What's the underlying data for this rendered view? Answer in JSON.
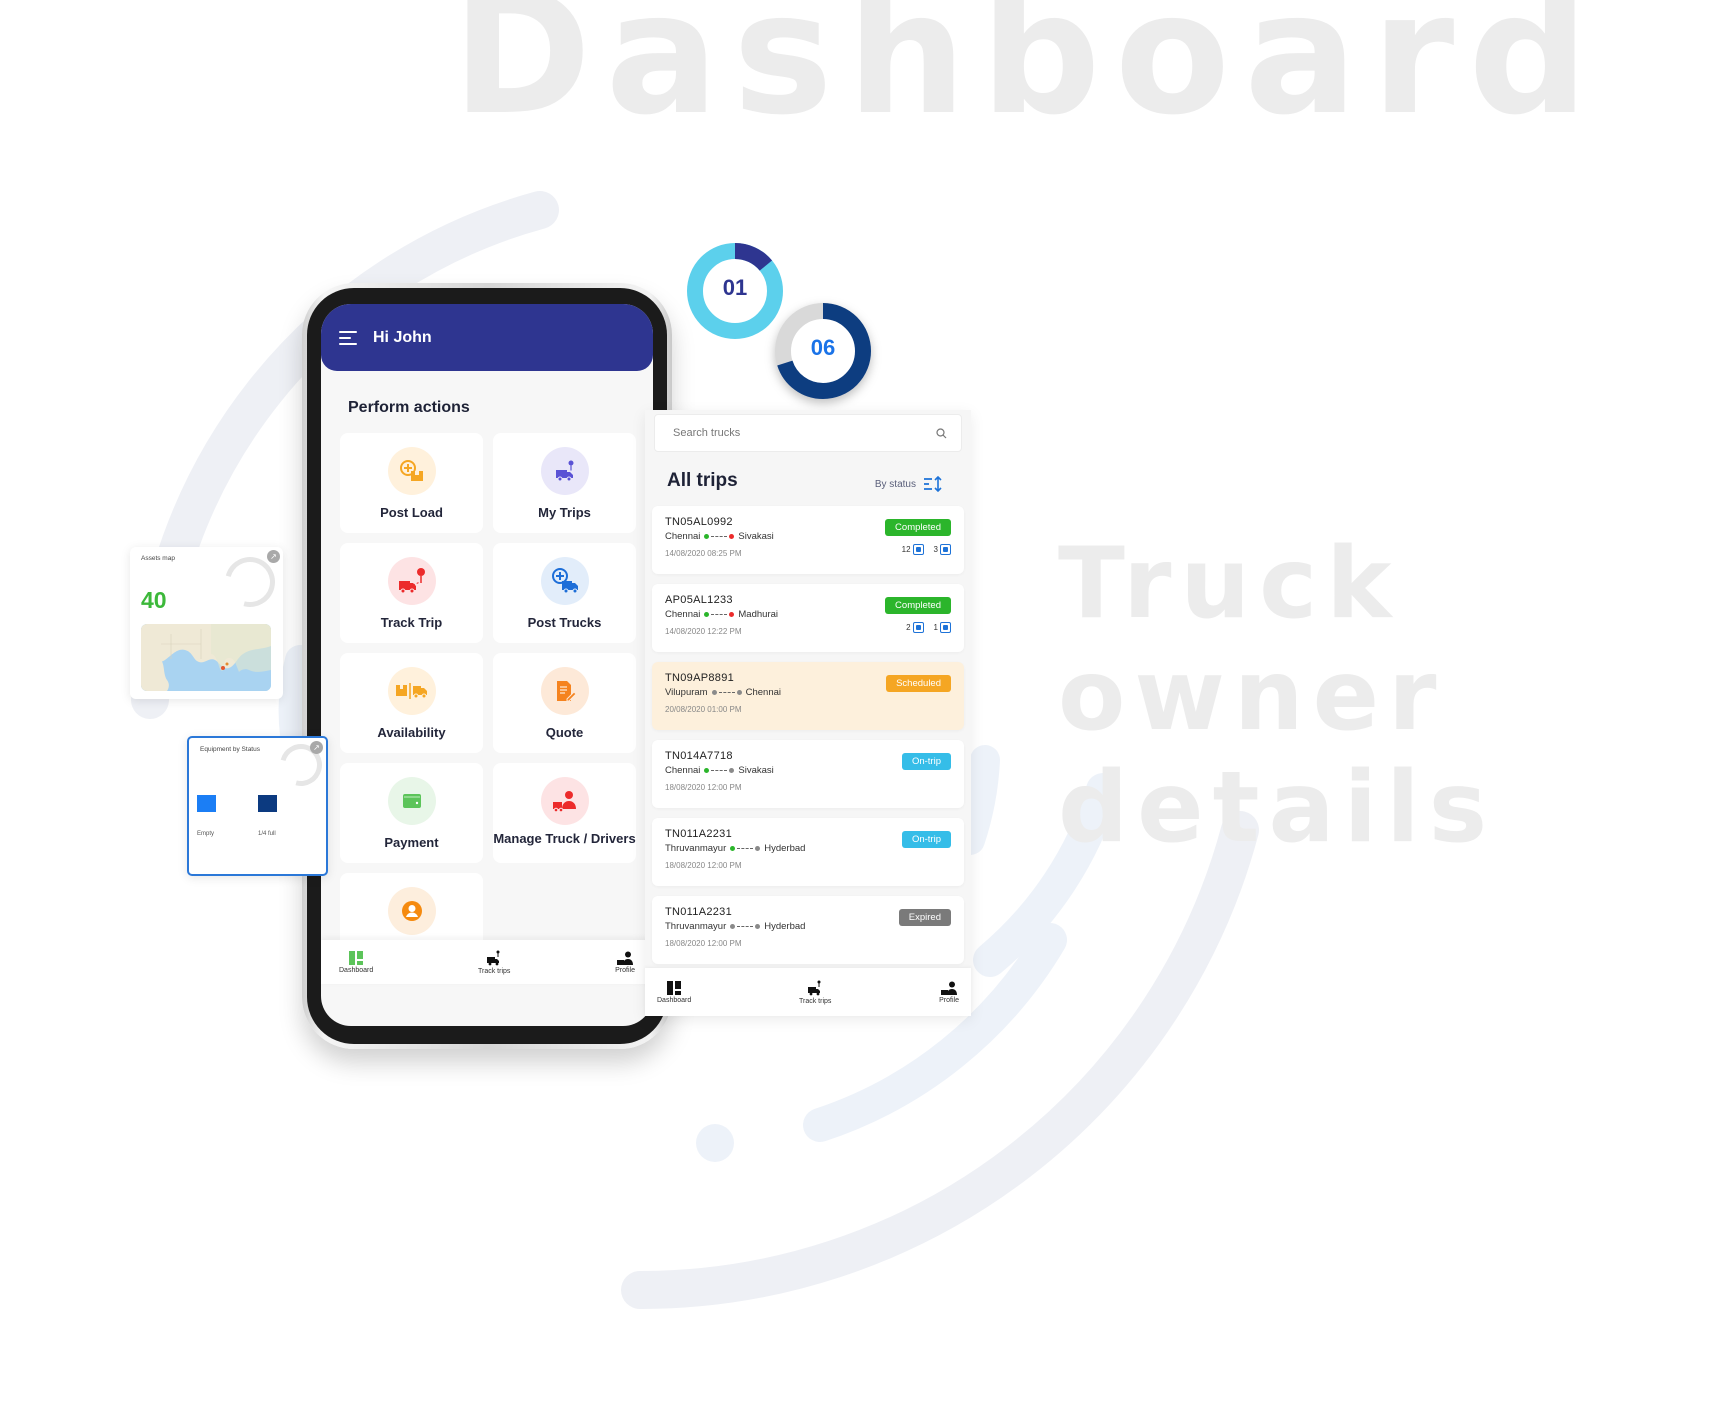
{
  "background": {
    "title": "Dashboard",
    "subtitle": "Truck owner details"
  },
  "donuts": [
    {
      "label": "01",
      "progress": 0.14,
      "track_color": "#5cd0ec",
      "fill_color": "#2e3590",
      "text_color": "#2e3590"
    },
    {
      "label": "06",
      "progress": 0.7,
      "track_color": "#d9d9d9",
      "fill_color": "#0d3d80",
      "text_color": "#1a73e8"
    }
  ],
  "phone": {
    "header": {
      "greeting": "Hi John",
      "menu_icon": "hamburger-menu-icon"
    },
    "section_title": "Perform actions",
    "actions": [
      {
        "label": "Post Load",
        "icon": "post-load-icon",
        "bg": "#fff1dc",
        "fg": "#f5a623"
      },
      {
        "label": "My Trips",
        "icon": "my-trips-icon",
        "bg": "#e9e7f9",
        "fg": "#5a52d5"
      },
      {
        "label": "Track Trip",
        "icon": "track-trip-icon",
        "bg": "#fde3e4",
        "fg": "#ec2b2b"
      },
      {
        "label": "Post Trucks",
        "icon": "post-trucks-icon",
        "bg": "#e2edfa",
        "fg": "#1d6ed8"
      },
      {
        "label": "Availability",
        "icon": "availability-icon",
        "bg": "#fff1dc",
        "fg": "#f5a623"
      },
      {
        "label": "Quote",
        "icon": "quote-icon",
        "bg": "#fde9d8",
        "fg": "#f5831f"
      },
      {
        "label": "Payment",
        "icon": "payment-icon",
        "bg": "#e8f6e8",
        "fg": "#5cc45a"
      },
      {
        "label": "Manage Truck / Drivers",
        "icon": "manage-truck-drivers-icon",
        "bg": "#fde3e4",
        "fg": "#ec2b2b"
      },
      {
        "label": "Profile",
        "icon": "profile-icon",
        "bg": "#fdeedd",
        "fg": "#f58a0f"
      }
    ],
    "bottom_nav": [
      {
        "label": "Dashboard",
        "icon": "dashboard-icon",
        "active": true
      },
      {
        "label": "Track trips",
        "icon": "track-trips-icon",
        "active": false
      },
      {
        "label": "Profile",
        "icon": "profile-nav-icon",
        "active": false
      }
    ]
  },
  "trips_panel": {
    "search_placeholder": "Search trucks",
    "title": "All trips",
    "sort_label": "By status",
    "trips": [
      {
        "plate": "TN05AL0992",
        "from": "Chennai",
        "to": "Sivakasi",
        "from_dot": "#2bb52b",
        "to_dot": "#ec2b2b",
        "datetime": "14/08/2020  08:25 PM",
        "status": "Completed",
        "status_color": "#2bb52b",
        "counts": [
          "12",
          "3"
        ],
        "highlight": false
      },
      {
        "plate": "AP05AL1233",
        "from": "Chennai",
        "to": "Madhurai",
        "from_dot": "#2bb52b",
        "to_dot": "#ec2b2b",
        "datetime": "14/08/2020  12:22 PM",
        "status": "Completed",
        "status_color": "#2bb52b",
        "counts": [
          "2",
          "1"
        ],
        "highlight": false
      },
      {
        "plate": "TN09AP8891",
        "from": "Vilupuram",
        "to": "Chennai",
        "from_dot": "#8a8a8a",
        "to_dot": "#8a8a8a",
        "datetime": "20/08/2020  01:00 PM",
        "status": "Scheduled",
        "status_color": "#f5a623",
        "counts": [],
        "highlight": true
      },
      {
        "plate": "TN014A7718",
        "from": "Chennai",
        "to": "Sivakasi",
        "from_dot": "#2bb52b",
        "to_dot": "#8a8a8a",
        "datetime": "18/08/2020  12:00 PM",
        "status": "On-trip",
        "status_color": "#35bde8",
        "counts": [],
        "highlight": false
      },
      {
        "plate": "TN011A2231",
        "from": "Thruvanmayur",
        "to": "Hyderbad",
        "from_dot": "#2bb52b",
        "to_dot": "#8a8a8a",
        "datetime": "18/08/2020  12:00 PM",
        "status": "On-trip",
        "status_color": "#35bde8",
        "counts": [],
        "highlight": false
      },
      {
        "plate": "TN011A2231",
        "from": "Thruvanmayur",
        "to": "Hyderbad",
        "from_dot": "#8a8a8a",
        "to_dot": "#8a8a8a",
        "datetime": "18/08/2020  12:00 PM",
        "status": "Expired",
        "status_color": "#7a7a7a",
        "counts": [],
        "highlight": false
      }
    ],
    "bottom_nav": [
      {
        "label": "Dashboard",
        "icon": "dashboard-icon"
      },
      {
        "label": "Track trips",
        "icon": "track-trips-icon"
      },
      {
        "label": "Profile",
        "icon": "profile-nav-icon"
      }
    ]
  },
  "assets_card": {
    "title": "Assets map",
    "count": "40",
    "count_color": "#3cb83a"
  },
  "equipment_card": {
    "title": "Equipment by Status",
    "legend": [
      {
        "label": "Empty",
        "color": "#1b7ef5"
      },
      {
        "label": "1/4 full",
        "color": "#0c3a80"
      }
    ]
  }
}
